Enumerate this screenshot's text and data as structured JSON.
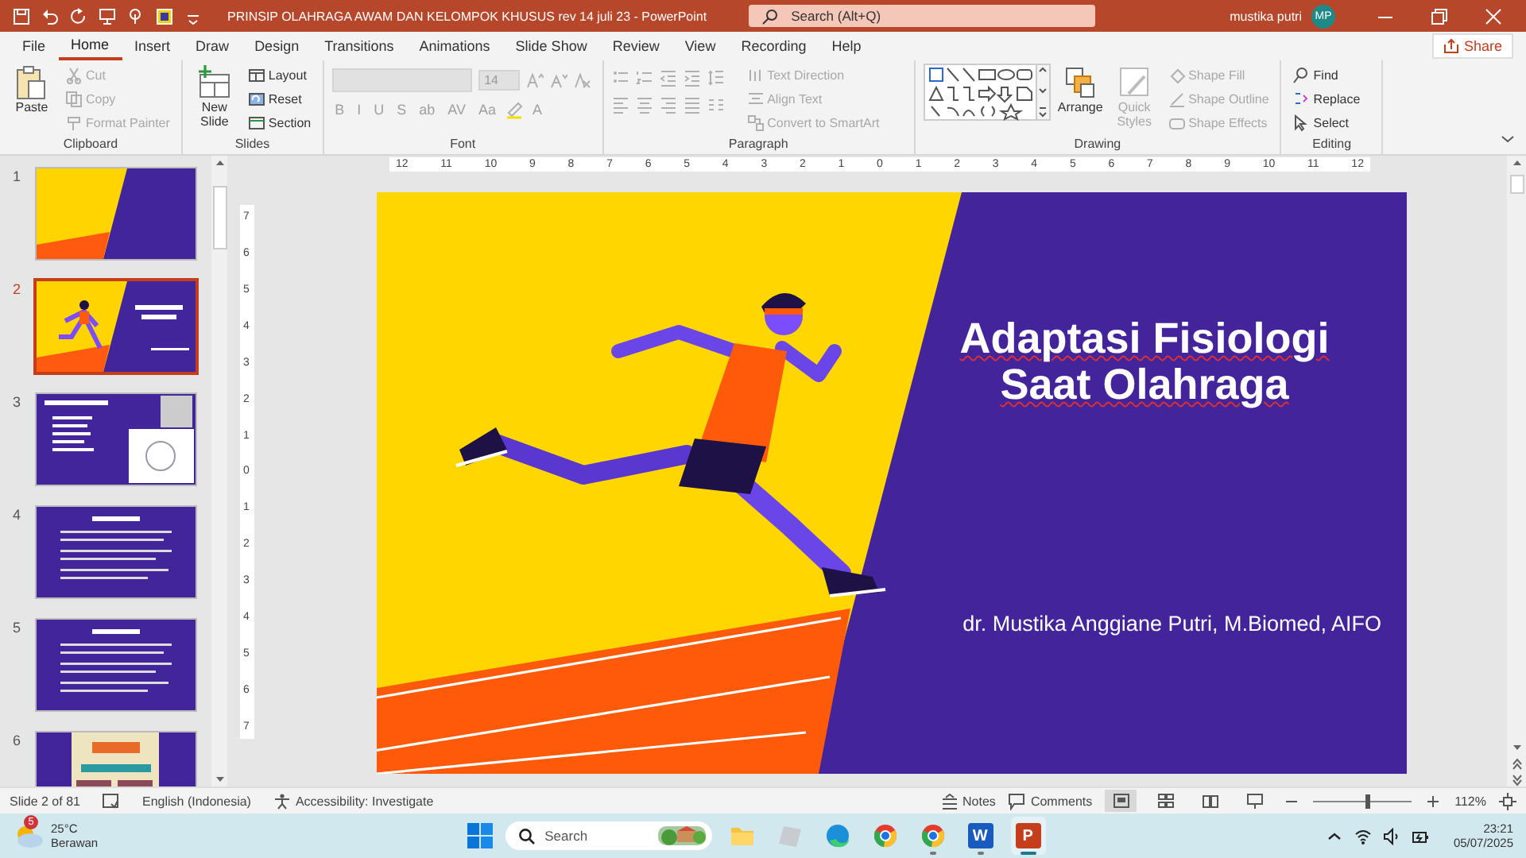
{
  "title_bar": {
    "document_title": "PRINSIP OLAHRAGA  AWAM DAN KELOMPOK KHUSUS rev 14 juli 23  -  PowerPoint",
    "search_placeholder": "Search (Alt+Q)",
    "user_name": "mustika putri",
    "avatar_initials": "MP"
  },
  "ribbon_tabs": [
    {
      "label": "File",
      "selected": false
    },
    {
      "label": "Home",
      "selected": true
    },
    {
      "label": "Insert",
      "selected": false
    },
    {
      "label": "Draw",
      "selected": false
    },
    {
      "label": "Design",
      "selected": false
    },
    {
      "label": "Transitions",
      "selected": false
    },
    {
      "label": "Animations",
      "selected": false
    },
    {
      "label": "Slide Show",
      "selected": false
    },
    {
      "label": "Review",
      "selected": false
    },
    {
      "label": "View",
      "selected": false
    },
    {
      "label": "Recording",
      "selected": false
    },
    {
      "label": "Help",
      "selected": false
    }
  ],
  "share_button": "Share",
  "ribbon_groups": [
    {
      "label": "Clipboard",
      "kind": "columns",
      "items": [
        {
          "label": "Paste",
          "kind": "large",
          "disabled": false
        },
        {
          "label": "Cut",
          "kind": "small",
          "disabled": true
        },
        {
          "label": "Copy",
          "kind": "small",
          "disabled": true
        },
        {
          "label": "Format Painter",
          "kind": "small",
          "disabled": true
        }
      ]
    },
    {
      "label": "Slides",
      "kind": "columns",
      "items": [
        {
          "label": "New Slide",
          "kind": "large",
          "disabled": false
        },
        {
          "label": "Layout",
          "kind": "small",
          "disabled": false
        },
        {
          "label": "Reset",
          "kind": "small",
          "disabled": false
        },
        {
          "label": "Section",
          "kind": "small",
          "disabled": false
        }
      ]
    },
    {
      "label": "Font",
      "kind": "font",
      "name_field": {
        "disabled": true
      },
      "size_field": {
        "label": "14",
        "disabled": true
      },
      "buttons": [
        {
          "kind": "icon",
          "disabled": true
        },
        {
          "kind": "icon",
          "disabled": true
        },
        {
          "kind": "icon",
          "disabled": true
        },
        {
          "kind": "glyph",
          "label": "B",
          "disabled": true
        },
        {
          "kind": "glyph",
          "label": "I",
          "disabled": true
        },
        {
          "kind": "glyph",
          "label": "U",
          "disabled": true
        },
        {
          "kind": "glyph",
          "label": "S",
          "disabled": true
        },
        {
          "kind": "glyph",
          "label": "ab",
          "disabled": true
        },
        {
          "kind": "glyph",
          "label": "AV",
          "disabled": true
        },
        {
          "kind": "glyph",
          "label": "Aa",
          "disabled": true
        },
        {
          "kind": "icon",
          "disabled": true
        },
        {
          "kind": "glyph",
          "label": "A",
          "disabled": true
        }
      ]
    },
    {
      "label": "Paragraph",
      "kind": "paragraph",
      "buttons": [
        {
          "kind": "icon",
          "disabled": true
        },
        {
          "kind": "icon",
          "disabled": true
        },
        {
          "kind": "icon",
          "disabled": true
        },
        {
          "kind": "icon",
          "disabled": true
        },
        {
          "kind": "icon",
          "disabled": true
        },
        {
          "kind": "icon",
          "disabled": true
        },
        {
          "kind": "icon",
          "disabled": true
        },
        {
          "kind": "icon",
          "disabled": true
        },
        {
          "kind": "icon",
          "disabled": true
        },
        {
          "kind": "icon",
          "disabled": true
        }
      ],
      "side_items": [
        {
          "label": "Text Direction",
          "kind": "small",
          "disabled": true
        },
        {
          "label": "Align Text",
          "kind": "small",
          "disabled": true
        },
        {
          "label": "Convert to SmartArt",
          "kind": "small",
          "disabled": true
        }
      ]
    },
    {
      "label": "Drawing",
      "kind": "columns",
      "items": [
        {
          "kind": "gallery"
        },
        {
          "label": "Arrange",
          "kind": "large",
          "disabled": false
        },
        {
          "label": "Quick Styles",
          "kind": "large",
          "disabled": true
        },
        {
          "label": "Shape Fill",
          "kind": "small",
          "disabled": true
        },
        {
          "label": "Shape Outline",
          "kind": "small",
          "disabled": true
        },
        {
          "label": "Shape Effects",
          "kind": "small",
          "disabled": true
        }
      ]
    },
    {
      "label": "Editing",
      "kind": "columns",
      "items": [
        {
          "label": "Find",
          "kind": "small",
          "disabled": false
        },
        {
          "label": "Replace",
          "kind": "small",
          "disabled": false
        },
        {
          "label": "Select",
          "kind": "small",
          "disabled": false
        }
      ]
    }
  ],
  "ruler": {
    "horizontal": [
      "12",
      "11",
      "10",
      "9",
      "8",
      "7",
      "6",
      "5",
      "4",
      "3",
      "2",
      "1",
      "0",
      "1",
      "2",
      "3",
      "4",
      "5",
      "6",
      "7",
      "8",
      "9",
      "10",
      "11",
      "12"
    ],
    "vertical": [
      "7",
      "6",
      "5",
      "4",
      "3",
      "2",
      "1",
      "0",
      "1",
      "2",
      "3",
      "4",
      "5",
      "6",
      "7"
    ]
  },
  "slides": [
    {
      "number": "1",
      "kind": "cover",
      "selected": false
    },
    {
      "number": "2",
      "kind": "runner",
      "selected": true
    },
    {
      "number": "3",
      "kind": "laws",
      "selected": false
    },
    {
      "number": "4",
      "kind": "text",
      "selected": false
    },
    {
      "number": "5",
      "kind": "text",
      "selected": false
    },
    {
      "number": "6",
      "kind": "poster",
      "selected": false
    }
  ],
  "slide": {
    "title_lines": [
      "Adaptasi Fisiologi",
      "Saat Olahraga"
    ],
    "spellcheck_flagged": true,
    "author": "dr. Mustika Anggiane Putri, M.Biomed, AIFO"
  },
  "status_bar": {
    "slide_counter": "Slide 2 of 81",
    "language": "English (Indonesia)",
    "accessibility": "Accessibility: Investigate",
    "notes": "Notes",
    "comments": "Comments",
    "views": [
      {
        "selected": true
      },
      {
        "selected": false
      },
      {
        "selected": false
      },
      {
        "selected": false
      }
    ],
    "zoom": {
      "level": 0.53,
      "reading": "112%"
    }
  },
  "taskbar": {
    "weather": {
      "badge": "5",
      "temperature": "25°C",
      "condition": "Berawan"
    },
    "search_placeholder": "Search",
    "apps": [
      {
        "kind": "folder",
        "running": false,
        "selected": false
      },
      {
        "kind": "roblox",
        "running": false,
        "selected": false
      },
      {
        "kind": "edge",
        "running": false,
        "selected": false
      },
      {
        "kind": "chrome",
        "running": false,
        "selected": false
      },
      {
        "kind": "chrome",
        "running": true,
        "selected": false
      },
      {
        "kind": "word",
        "label": "W",
        "running": true,
        "selected": false
      },
      {
        "kind": "powerpoint",
        "label": "P",
        "running": true,
        "selected": true
      }
    ],
    "time": "23:21",
    "date": "05/07/2025"
  }
}
